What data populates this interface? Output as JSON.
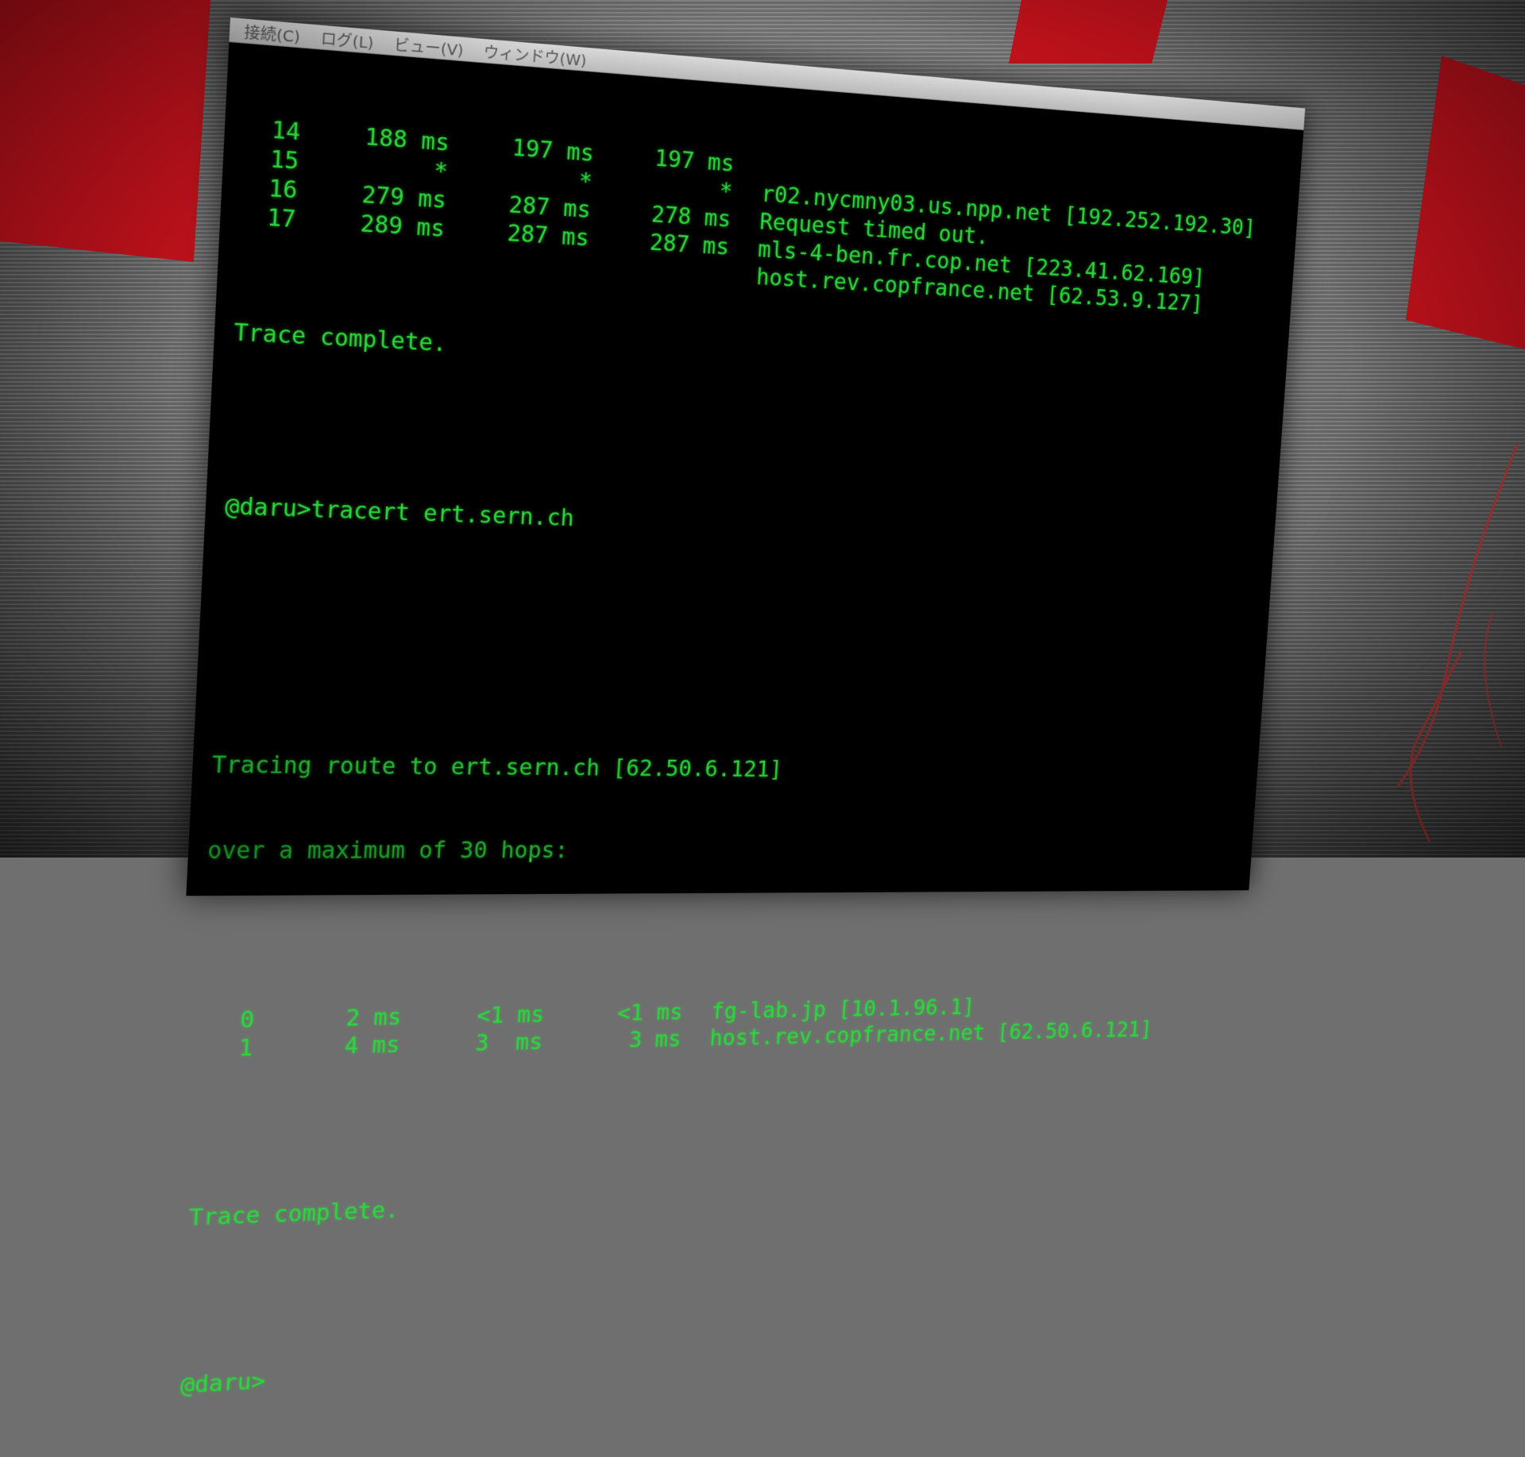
{
  "window": {
    "menu": [
      "接続(C)",
      "ログ(L)",
      "ビュー(V)",
      "ウィンドウ(W)"
    ]
  },
  "console": {
    "prev_hops": [
      {
        "n": "14",
        "t1": "188 ms",
        "t2": "197 ms",
        "t3": "197 ms",
        "host": ""
      },
      {
        "n": "15",
        "t1": "*",
        "t2": "*",
        "t3": "*",
        "host": "r02.nycmny03.us.npp.net [192.252.192.30]"
      },
      {
        "n": "16",
        "t1": "279 ms",
        "t2": "287 ms",
        "t3": "278 ms",
        "host": "Request timed out."
      },
      {
        "n": "17",
        "t1": "289 ms",
        "t2": "287 ms",
        "t3": "287 ms",
        "host": "mls-4-ben.fr.cop.net [223.41.62.169]"
      },
      {
        "n": "",
        "t1": "",
        "t2": "",
        "t3": "",
        "host": "host.rev.copfrance.net [62.53.9.127]"
      }
    ],
    "trace_complete_1": "Trace complete.",
    "command": "@daru>tracert ert.sern.ch",
    "tracing_line": "Tracing route to ert.sern.ch [62.50.6.121]",
    "max_hops_line": "over a maximum of 30 hops:",
    "hops": [
      {
        "n": "0",
        "t1": "2 ms",
        "t2": "<1 ms",
        "t3": "<1 ms",
        "host": "fg-lab.jp [10.1.96.1]"
      },
      {
        "n": "1",
        "t1": "4 ms",
        "t2": "3  ms",
        "t3": "3 ms",
        "host": "host.rev.copfrance.net [62.50.6.121]"
      }
    ],
    "trace_complete_2": "Trace complete.",
    "prompt": "@daru>"
  },
  "colors": {
    "terminal_text": "#2bd83c",
    "terminal_bg": "#000000",
    "accent_red": "#c1121c"
  }
}
